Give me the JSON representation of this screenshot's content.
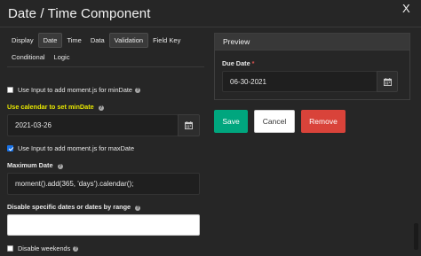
{
  "dialog": {
    "title": "Date / Time Component",
    "close_label": "X"
  },
  "tabs": [
    {
      "label": "Display",
      "active": false
    },
    {
      "label": "Date",
      "active": true
    },
    {
      "label": "Time",
      "active": false
    },
    {
      "label": "Data",
      "active": false
    },
    {
      "label": "Validation",
      "active": false
    },
    {
      "label": "Field Key",
      "active": false
    },
    {
      "label": "Conditional",
      "active": false
    },
    {
      "label": "Logic",
      "active": false
    }
  ],
  "form": {
    "min_moment_checkbox": {
      "label": "Use Input to add moment.js for minDate",
      "checked": false
    },
    "min_calendar_label": "Use calendar to set minDate",
    "min_date_value": "2021-03-26",
    "max_moment_checkbox": {
      "label": "Use Input to add moment.js for maxDate",
      "checked": true
    },
    "max_date_label": "Maximum Date",
    "max_date_value": "moment().add(365, 'days').calendar();",
    "disable_dates_label": "Disable specific dates or dates by range",
    "disable_dates_value": "",
    "disable_weekends": {
      "label": "Disable weekends",
      "checked": false
    }
  },
  "preview": {
    "heading": "Preview",
    "due_date_label": "Due Date",
    "required_mark": "*",
    "due_date_value": "06-30-2021"
  },
  "buttons": {
    "save": "Save",
    "cancel": "Cancel",
    "remove": "Remove"
  },
  "icons": [
    "close-icon",
    "help-icon",
    "calendar-icon",
    "checkbox-icon"
  ],
  "colors": {
    "background": "#262626",
    "highlight_label": "#e6e600",
    "save": "#00a67e",
    "remove": "#d9433a",
    "checkbox_checked": "#1a73e8"
  }
}
